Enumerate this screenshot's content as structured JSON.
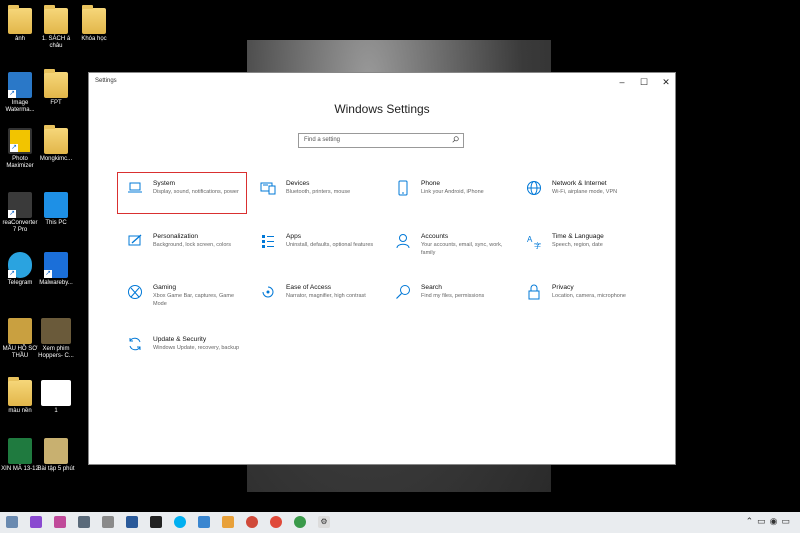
{
  "desktop_icons": [
    {
      "label": "ảnh"
    },
    {
      "label": "1. SÁCH á châu"
    },
    {
      "label": "Khóa học"
    },
    {
      "label": "Image Waterma..."
    },
    {
      "label": "FPT"
    },
    {
      "label": "Photo Maximizer"
    },
    {
      "label": "Mongkimc..."
    },
    {
      "label": "reaConverter 7 Pro"
    },
    {
      "label": "This PC"
    },
    {
      "label": "Telegram"
    },
    {
      "label": "Malwareby..."
    },
    {
      "label": "MẪU HỒ SƠ THẦU"
    },
    {
      "label": "Xem phim Hoppers- C..."
    },
    {
      "label": "màu nền"
    },
    {
      "label": "1"
    },
    {
      "label": "XIN MÃ 13-12"
    },
    {
      "label": "Bài tập 5 phút"
    }
  ],
  "window": {
    "title": "Settings",
    "heading": "Windows Settings",
    "search_placeholder": "Find a setting",
    "tiles": [
      {
        "name": "System",
        "desc": "Display, sound, notifications, power",
        "icon": "laptop-icon"
      },
      {
        "name": "Devices",
        "desc": "Bluetooth, printers, mouse",
        "icon": "keyboard-icon"
      },
      {
        "name": "Phone",
        "desc": "Link your Android, iPhone",
        "icon": "phone-icon"
      },
      {
        "name": "Network & Internet",
        "desc": "Wi-Fi, airplane mode, VPN",
        "icon": "globe-icon"
      },
      {
        "name": "Personalization",
        "desc": "Background, lock screen, colors",
        "icon": "paintbrush-icon"
      },
      {
        "name": "Apps",
        "desc": "Uninstall, defaults, optional features",
        "icon": "apps-list-icon"
      },
      {
        "name": "Accounts",
        "desc": "Your accounts, email, sync, work, family",
        "icon": "person-icon"
      },
      {
        "name": "Time & Language",
        "desc": "Speech, region, date",
        "icon": "time-language-icon"
      },
      {
        "name": "Gaming",
        "desc": "Xbox Game Bar, captures, Game Mode",
        "icon": "xbox-icon"
      },
      {
        "name": "Ease of Access",
        "desc": "Narrator, magnifier, high contrast",
        "icon": "ease-of-access-icon"
      },
      {
        "name": "Search",
        "desc": "Find my files, permissions",
        "icon": "search-icon"
      },
      {
        "name": "Privacy",
        "desc": "Location, camera, microphone",
        "icon": "lock-icon"
      },
      {
        "name": "Update & Security",
        "desc": "Windows Update, recovery, backup",
        "icon": "refresh-icon"
      }
    ]
  },
  "colors": {
    "accent": "#0078d7",
    "highlight": "#d93030"
  }
}
